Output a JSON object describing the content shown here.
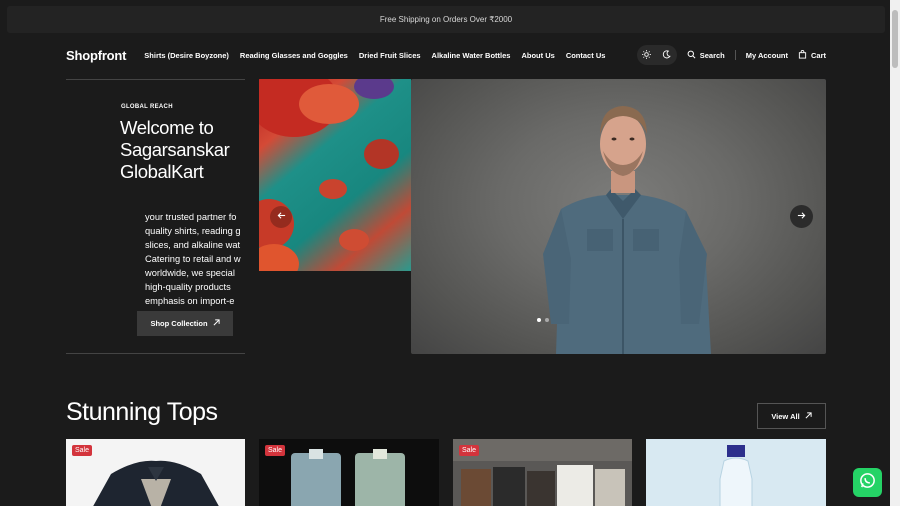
{
  "announcement": "Free Shipping on Orders Over ₹2000",
  "header": {
    "logo": "Shopfront",
    "nav": [
      "Shirts (Desire Boyzone)",
      "Reading Glasses and Goggles",
      "Dried Fruit Slices",
      "Alkaline Water Bottles",
      "About Us",
      "Contact Us"
    ],
    "search_label": "Search",
    "account_label": "My Account",
    "cart_label": "Cart"
  },
  "hero": {
    "eyebrow": "GLOBAL REACH",
    "title_lines": [
      "Welcome to",
      "Sagarsanskar",
      "GlobalKart"
    ],
    "desc_lines": [
      "your trusted partner fo",
      "quality shirts, reading g",
      "slices, and alkaline wat",
      "Catering to retail and w",
      "worldwide, we special",
      "high-quality products",
      "emphasis on import-e"
    ],
    "cta_label": "Shop Collection",
    "slide_count": 2,
    "active_slide": 1
  },
  "section": {
    "title": "Stunning Tops",
    "view_all_label": "View All"
  },
  "products": [
    {
      "badge": "Sale"
    },
    {
      "badge": "Sale"
    },
    {
      "badge": "Sale"
    },
    {
      "badge": ""
    }
  ],
  "icons": {
    "sun": "sun-icon",
    "moon": "moon-icon",
    "search": "search-icon",
    "cart": "cart-icon",
    "arrow_up_right": "arrow-up-right-icon",
    "arrow_left": "arrow-left-icon",
    "arrow_right": "arrow-right-icon",
    "whatsapp": "whatsapp-icon"
  },
  "colors": {
    "background": "#1b1b1b",
    "sale_badge": "#d3343c",
    "whatsapp": "#25d366"
  }
}
